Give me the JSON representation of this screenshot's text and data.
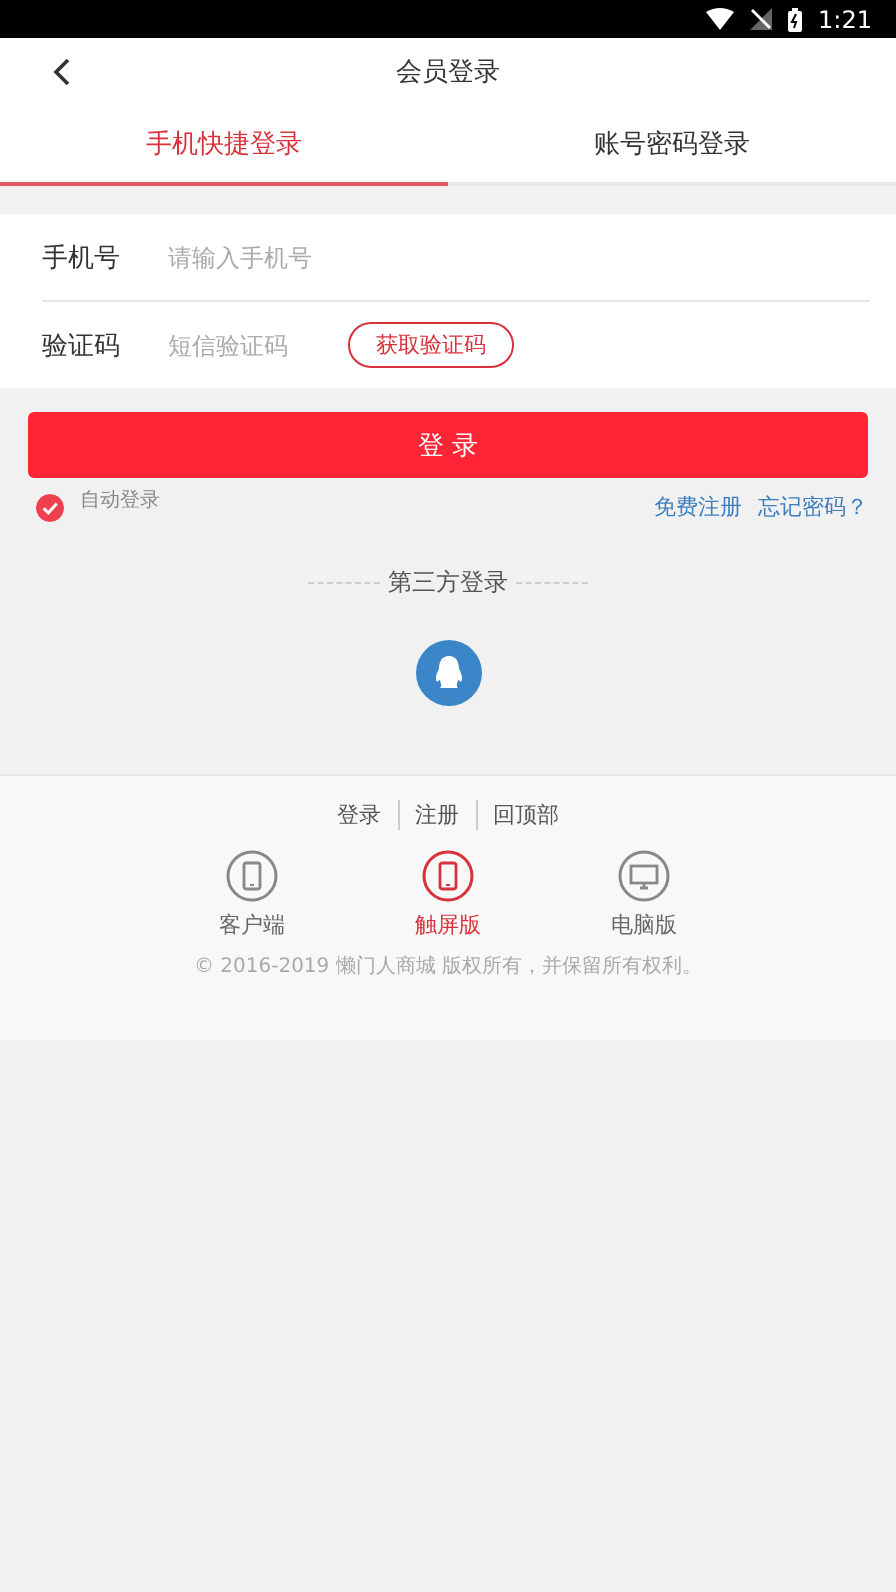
{
  "status_bar": {
    "time": "1:21"
  },
  "header": {
    "title": "会员登录"
  },
  "tabs": [
    {
      "label": "手机快捷登录",
      "selected": true
    },
    {
      "label": "账号密码登录",
      "selected": false
    }
  ],
  "form": {
    "fields": [
      {
        "label": "手机号",
        "placeholder": "请输入手机号"
      },
      {
        "label": "验证码",
        "placeholder": "短信验证码",
        "button": "获取验证码"
      }
    ]
  },
  "login_button": "登 录",
  "auto_login": {
    "label": "自动登录",
    "checked": true
  },
  "links": [
    "免费注册",
    "忘记密码？"
  ],
  "third_party": {
    "title": "第三方登录"
  },
  "footer": {
    "links": [
      "登录",
      "注册",
      "回顶部"
    ],
    "versions": [
      {
        "label": "客户端",
        "kind": "phone",
        "selected": false
      },
      {
        "label": "触屏版",
        "kind": "phone",
        "selected": true
      },
      {
        "label": "电脑版",
        "kind": "monitor",
        "selected": false
      }
    ],
    "copyright": "© 2016-2019 懒门人商城 版权所有，并保留所有权利。"
  }
}
